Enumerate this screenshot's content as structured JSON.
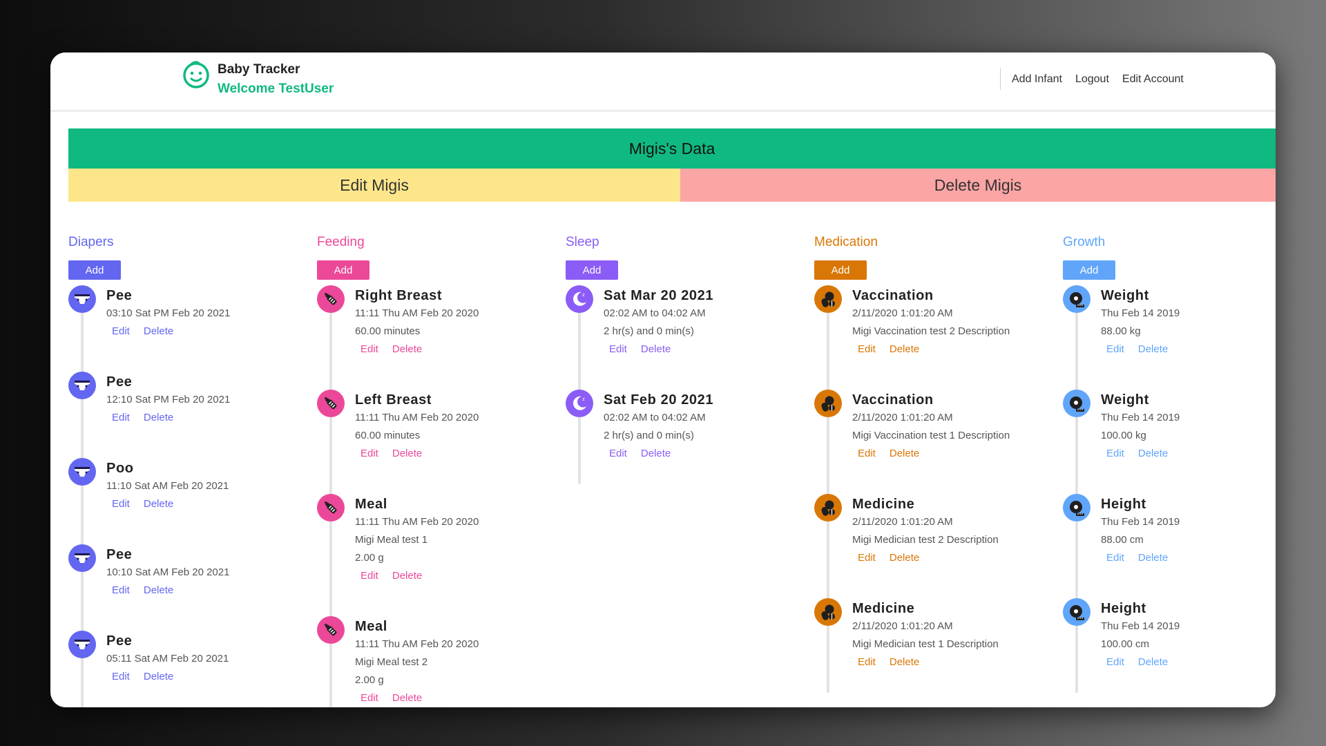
{
  "header": {
    "app_title": "Baby Tracker",
    "welcome": "Welcome TestUser",
    "nav": [
      "Add Infant",
      "Logout",
      "Edit Account"
    ]
  },
  "infant": {
    "banner": "Migis's Data",
    "edit_label": "Edit Migis",
    "delete_label": "Delete Migis"
  },
  "colors": {
    "diapers": "#6366f1",
    "feeding": "#ec4899",
    "sleep": "#8b5cf6",
    "medication": "#d97706",
    "growth": "#60a5fa",
    "banner": "#10b981",
    "edit_infant": "#fde68a",
    "delete_infant": "#fca5a5"
  },
  "columns": [
    {
      "key": "diapers",
      "title": "Diapers",
      "add_label": "Add",
      "icon": "diaper-icon",
      "entries": [
        {
          "title": "Pee",
          "lines": [
            "03:10 Sat PM Feb 20 2021"
          ]
        },
        {
          "title": "Pee",
          "lines": [
            "12:10 Sat PM Feb 20 2021"
          ]
        },
        {
          "title": "Poo",
          "lines": [
            "11:10 Sat AM Feb 20 2021"
          ]
        },
        {
          "title": "Pee",
          "lines": [
            "10:10 Sat AM Feb 20 2021"
          ]
        },
        {
          "title": "Pee",
          "lines": [
            "05:11 Sat AM Feb 20 2021"
          ]
        }
      ]
    },
    {
      "key": "feeding",
      "title": "Feeding",
      "add_label": "Add",
      "icon": "bottle-icon",
      "entries": [
        {
          "title": "Right Breast",
          "lines": [
            "11:11 Thu AM Feb 20 2020",
            "60.00 minutes"
          ]
        },
        {
          "title": "Left Breast",
          "lines": [
            "11:11 Thu AM Feb 20 2020",
            "60.00 minutes"
          ]
        },
        {
          "title": "Meal",
          "lines": [
            "11:11 Thu AM Feb 20 2020",
            "Migi Meal test 1",
            "2.00 g"
          ]
        },
        {
          "title": "Meal",
          "lines": [
            "11:11 Thu AM Feb 20 2020",
            "Migi Meal test 2",
            "2.00 g"
          ]
        }
      ]
    },
    {
      "key": "sleep",
      "title": "Sleep",
      "add_label": "Add",
      "icon": "moon-icon",
      "entries": [
        {
          "title": "Sat Mar 20 2021",
          "lines": [
            "02:02 AM to 04:02 AM",
            "2 hr(s) and 0 min(s)"
          ]
        },
        {
          "title": "Sat Feb 20 2021",
          "lines": [
            "02:02 AM to 04:02 AM",
            "2 hr(s) and 0 min(s)"
          ]
        }
      ]
    },
    {
      "key": "medication",
      "title": "Medication",
      "add_label": "Add",
      "icon": "pills-icon",
      "entries": [
        {
          "title": "Vaccination",
          "lines": [
            "2/11/2020 1:01:20 AM",
            "Migi Vaccination test 2 Description"
          ]
        },
        {
          "title": "Vaccination",
          "lines": [
            "2/11/2020 1:01:20 AM",
            "Migi Vaccination test 1 Description"
          ]
        },
        {
          "title": "Medicine",
          "lines": [
            "2/11/2020 1:01:20 AM",
            "Migi Medician test 2 Description"
          ]
        },
        {
          "title": "Medicine",
          "lines": [
            "2/11/2020 1:01:20 AM",
            "Migi Medician test 1 Description"
          ]
        }
      ]
    },
    {
      "key": "growth",
      "title": "Growth",
      "add_label": "Add",
      "icon": "tape-measure-icon",
      "entries": [
        {
          "title": "Weight",
          "lines": [
            "Thu Feb 14 2019",
            "88.00 kg"
          ]
        },
        {
          "title": "Weight",
          "lines": [
            "Thu Feb 14 2019",
            "100.00 kg"
          ]
        },
        {
          "title": "Height",
          "lines": [
            "Thu Feb 14 2019",
            "88.00 cm"
          ]
        },
        {
          "title": "Height",
          "lines": [
            "Thu Feb 14 2019",
            "100.00 cm"
          ]
        }
      ]
    }
  ],
  "entry_actions": {
    "edit": "Edit",
    "delete": "Delete"
  }
}
